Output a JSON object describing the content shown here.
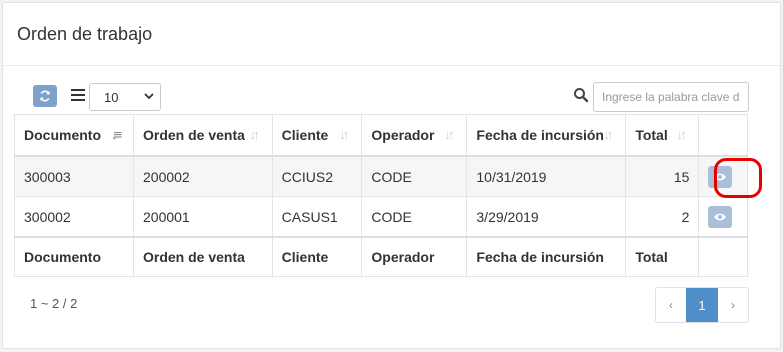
{
  "panel": {
    "title": "Orden de trabajo"
  },
  "toolbar": {
    "page_size": "10",
    "search_placeholder": "Ingrese la palabra clave d"
  },
  "table": {
    "headers": [
      "Documento",
      "Orden de venta",
      "Cliente",
      "Operador",
      "Fecha de incursión",
      "Total"
    ],
    "rows": [
      {
        "documento": "300003",
        "orden": "200002",
        "cliente": "CCIUS2",
        "operador": "CODE",
        "fecha": "10/31/2019",
        "total": "15"
      },
      {
        "documento": "300002",
        "orden": "200001",
        "cliente": "CASUS1",
        "operador": "CODE",
        "fecha": "3/29/2019",
        "total": "2"
      }
    ],
    "footers": [
      "Documento",
      "Orden de venta",
      "Cliente",
      "Operador",
      "Fecha de incursión",
      "Total"
    ]
  },
  "pagination": {
    "info": "1 ~ 2 / 2",
    "prev": "‹",
    "current": "1",
    "next": "›"
  },
  "colors": {
    "accent": "#4f8ec9",
    "highlight": "#e60000",
    "button": "#a9bfd8"
  }
}
